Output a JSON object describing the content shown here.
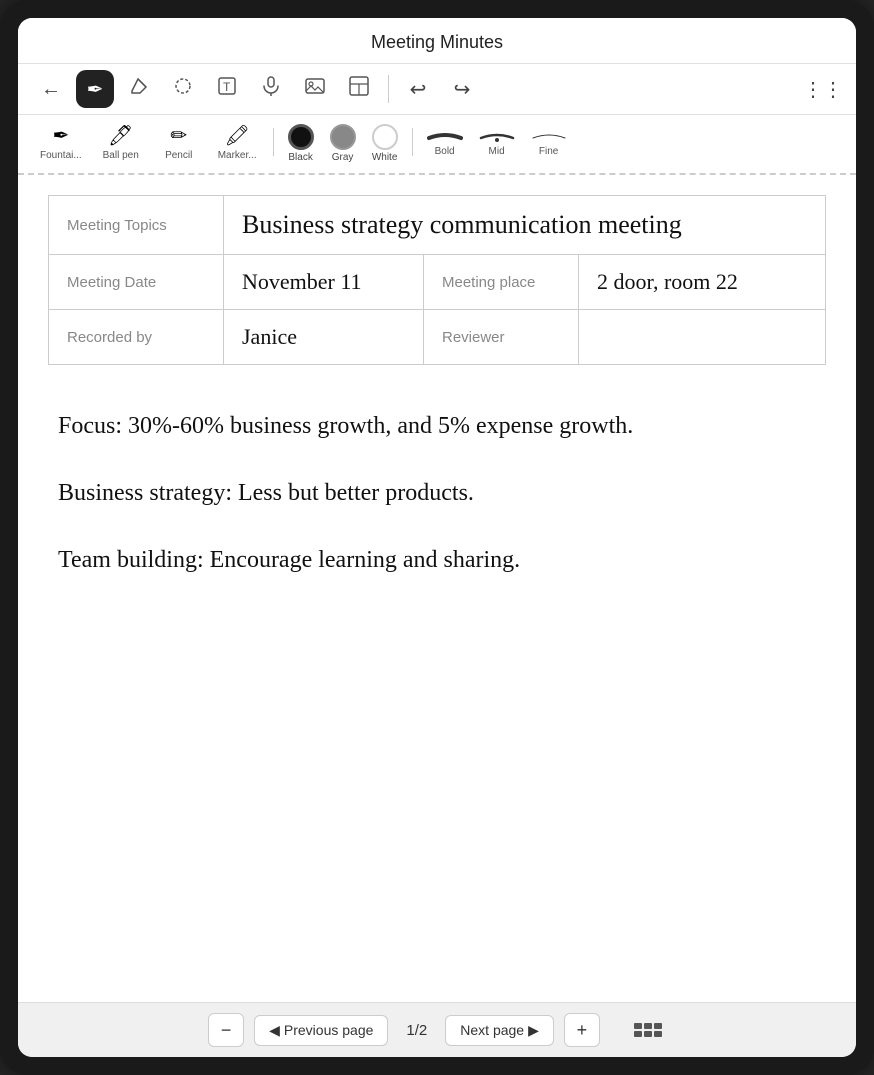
{
  "app": {
    "title": "Meeting Minutes"
  },
  "toolbar": {
    "back_label": "←",
    "tools": [
      {
        "id": "pen",
        "label": "✏",
        "active": true
      },
      {
        "id": "eraser",
        "label": "◇"
      },
      {
        "id": "lasso",
        "label": "⊙"
      },
      {
        "id": "text",
        "label": "T"
      },
      {
        "id": "mic",
        "label": "🎤"
      },
      {
        "id": "image",
        "label": "🖼"
      },
      {
        "id": "layout",
        "label": "⊞"
      }
    ],
    "undo_label": "↩",
    "redo_label": "↪",
    "more_label": "⋮⋮"
  },
  "sub_toolbar": {
    "pens": [
      {
        "id": "fountain",
        "label": "Fountai..."
      },
      {
        "id": "ballpen",
        "label": "Ball pen"
      },
      {
        "id": "pencil",
        "label": "Pencil"
      },
      {
        "id": "marker",
        "label": "Marker..."
      }
    ],
    "colors": [
      {
        "id": "black",
        "label": "Black",
        "selected": true
      },
      {
        "id": "gray",
        "label": "Gray"
      },
      {
        "id": "white",
        "label": "White"
      }
    ],
    "strokes": [
      {
        "id": "bold",
        "label": "Bold"
      },
      {
        "id": "mid",
        "label": "Mid"
      },
      {
        "id": "fine",
        "label": "Fine"
      }
    ]
  },
  "table": {
    "rows": [
      {
        "col1_label": "Meeting Topics",
        "col1_value": "Business strategy communication meeting",
        "col2_label": "",
        "col2_value": ""
      },
      {
        "col1_label": "Meeting Date",
        "col1_value": "November 11",
        "col2_label": "Meeting place",
        "col2_value": "2 door, room 22"
      },
      {
        "col1_label": "Recorded by",
        "col1_value": "Janice",
        "col2_label": "Reviewer",
        "col2_value": ""
      }
    ]
  },
  "notes": [
    "Focus: 30%-60% business growth, and 5% expense growth.",
    "Business strategy: Less but better products.",
    "Team building: Encourage learning and sharing."
  ],
  "bottom_bar": {
    "minus_label": "−",
    "prev_label": "◀ Previous page",
    "page_indicator": "1/2",
    "next_label": "Next page ▶",
    "plus_label": "+"
  }
}
